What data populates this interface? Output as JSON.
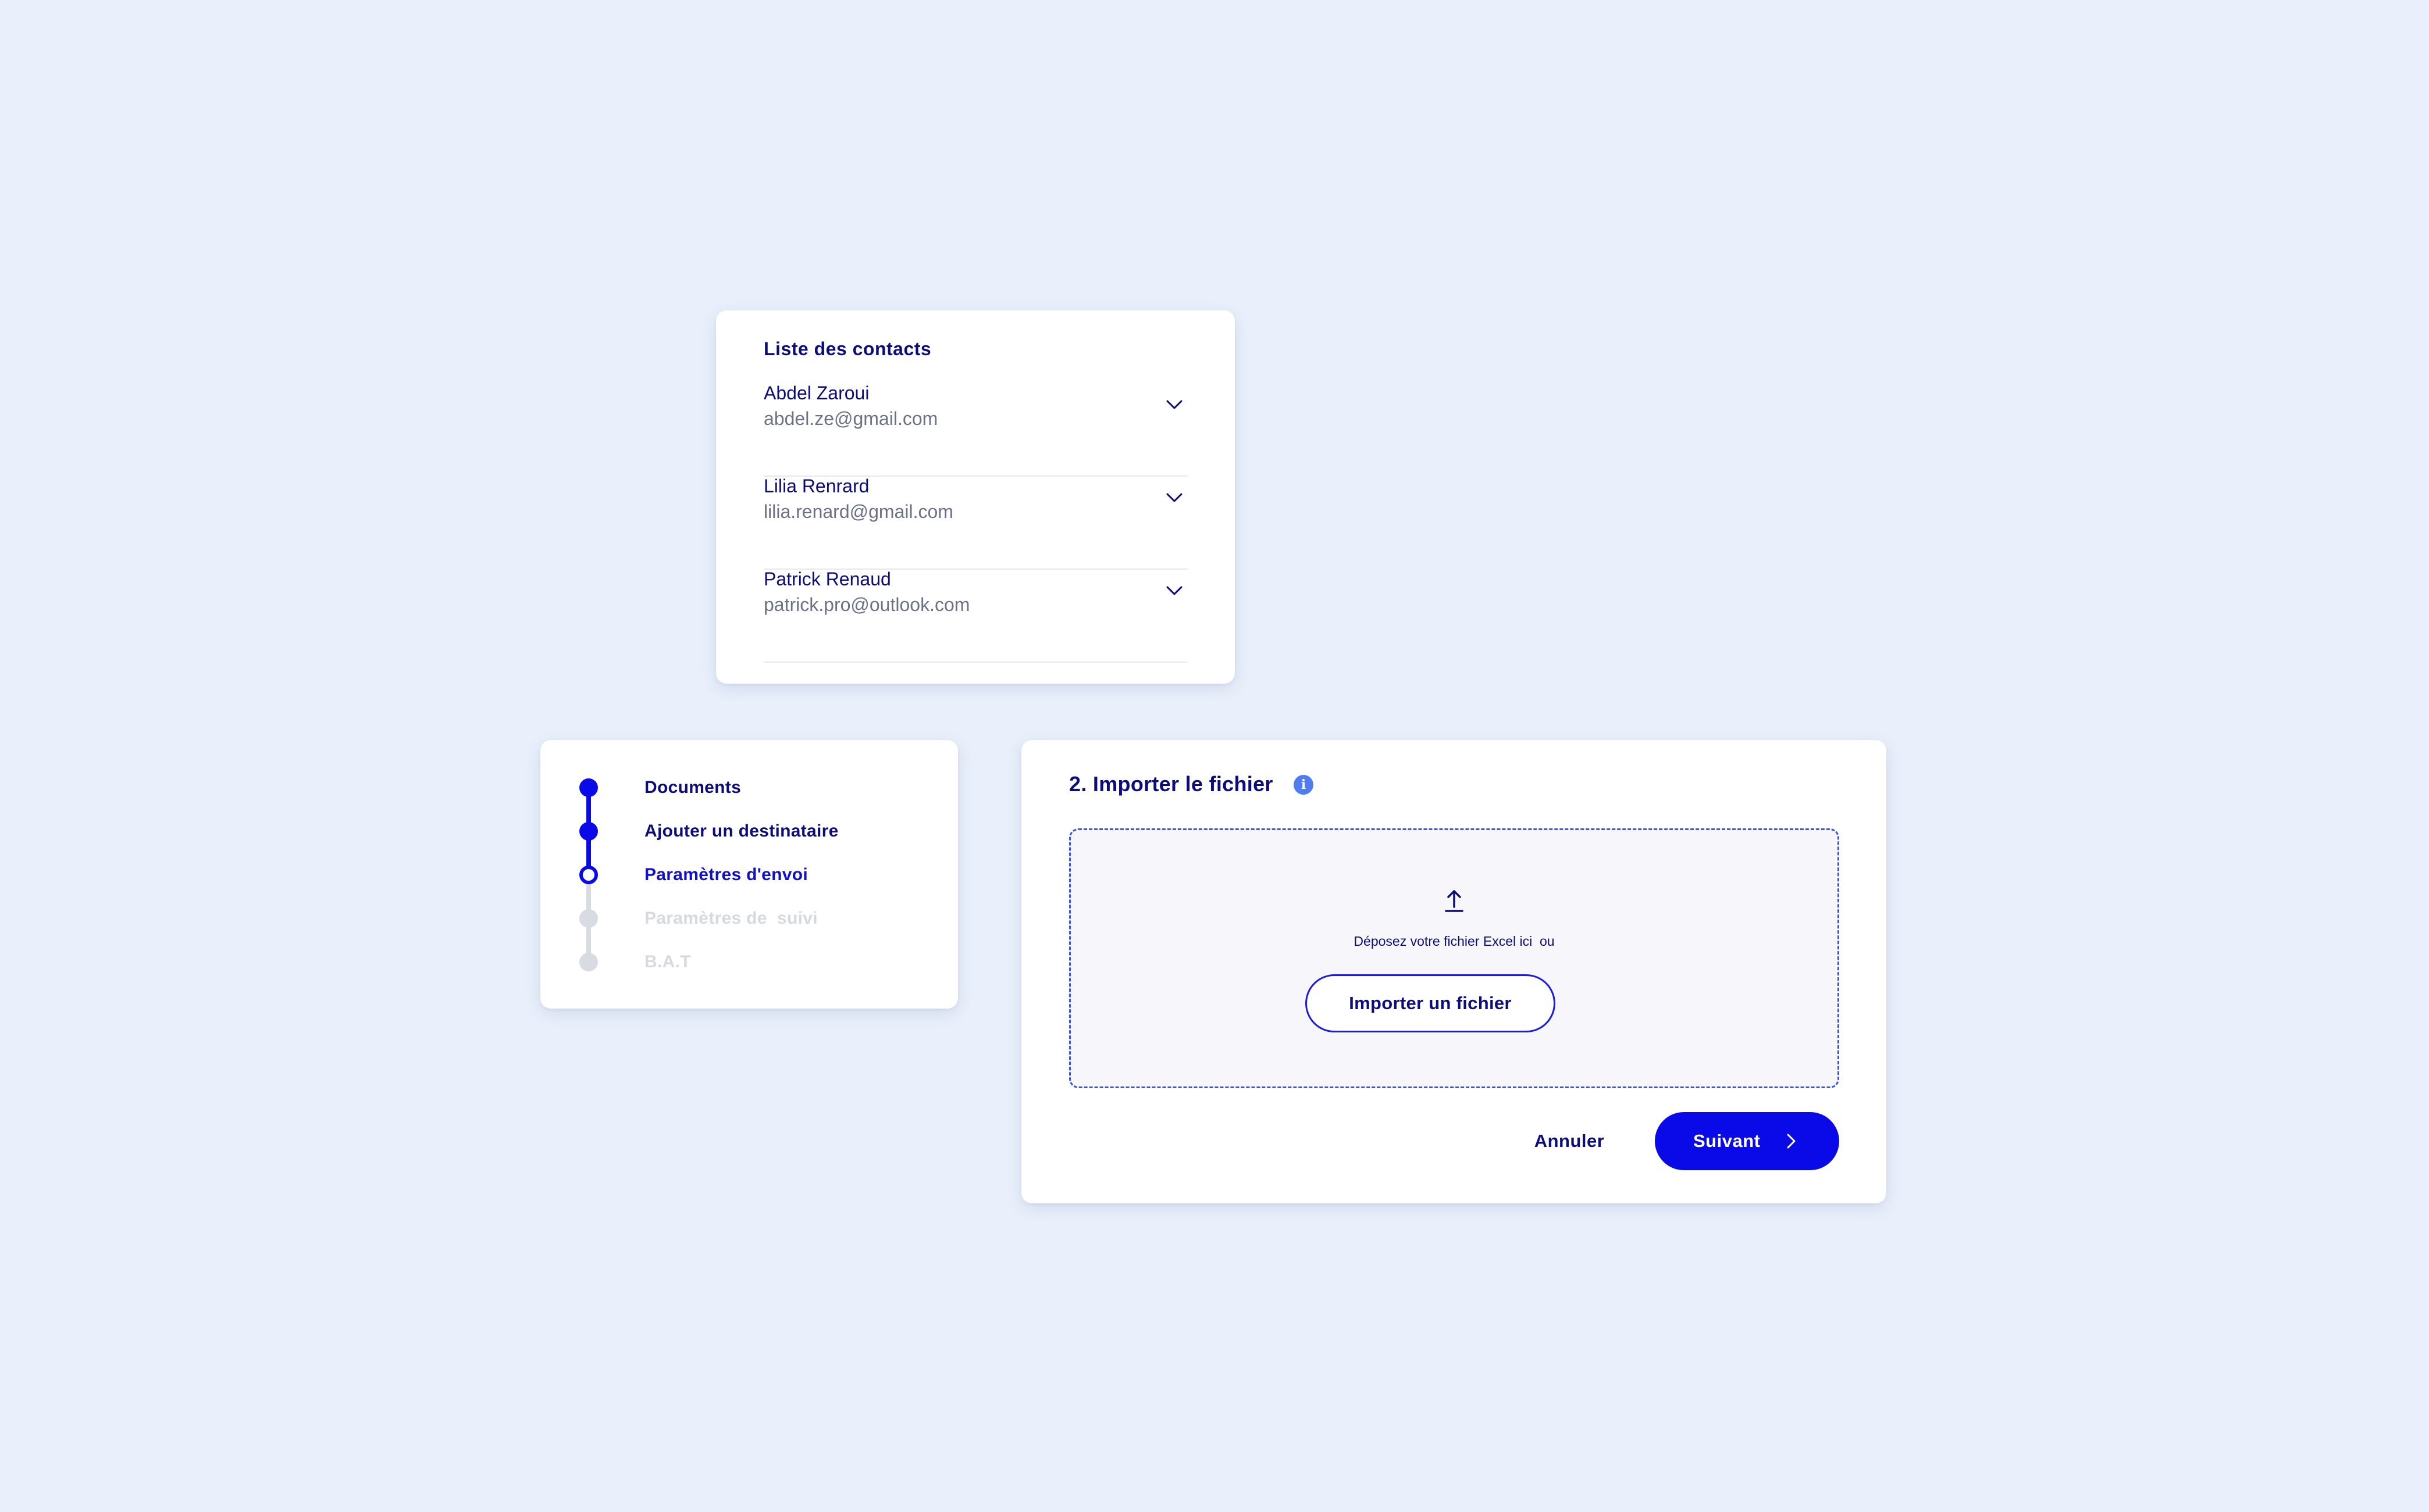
{
  "contacts": {
    "title": "Liste des contacts",
    "items": [
      {
        "name": "Abdel Zaroui",
        "email": "abdel.ze@gmail.com",
        "icon": "chevron-down-icon"
      },
      {
        "name": "Lilia Renrard",
        "email": "lilia.renard@gmail.com",
        "icon": "chevron-down-icon"
      },
      {
        "name": "Patrick Renaud",
        "email": "patrick.pro@outlook.com",
        "icon": "chevron-down-icon"
      }
    ]
  },
  "stepper": {
    "steps": [
      {
        "label": "Documents",
        "state": "done"
      },
      {
        "label": "Ajouter un destinataire",
        "state": "done"
      },
      {
        "label": "Paramètres d'envoi",
        "state": "current"
      },
      {
        "label": "Paramètres de  suivi",
        "state": "todo"
      },
      {
        "label": "B.A.T",
        "state": "todo"
      }
    ]
  },
  "import": {
    "title": "2. Importer le fichier",
    "info_icon": "i",
    "dropzone_text": "Déposez votre fichier Excel ici  ou",
    "upload_icon": "upload-arrow-icon",
    "import_button": "Importer un fichier",
    "cancel_button": "Annuler",
    "next_button": "Suivant",
    "next_icon": "chevron-right-icon"
  },
  "colors": {
    "background": "#e9f0fb",
    "primary": "#0a0ae8",
    "text_dark": "#0d0d7a",
    "text_muted": "#6d7188",
    "inactive": "#d8dbe2",
    "info": "#4f7df0"
  }
}
